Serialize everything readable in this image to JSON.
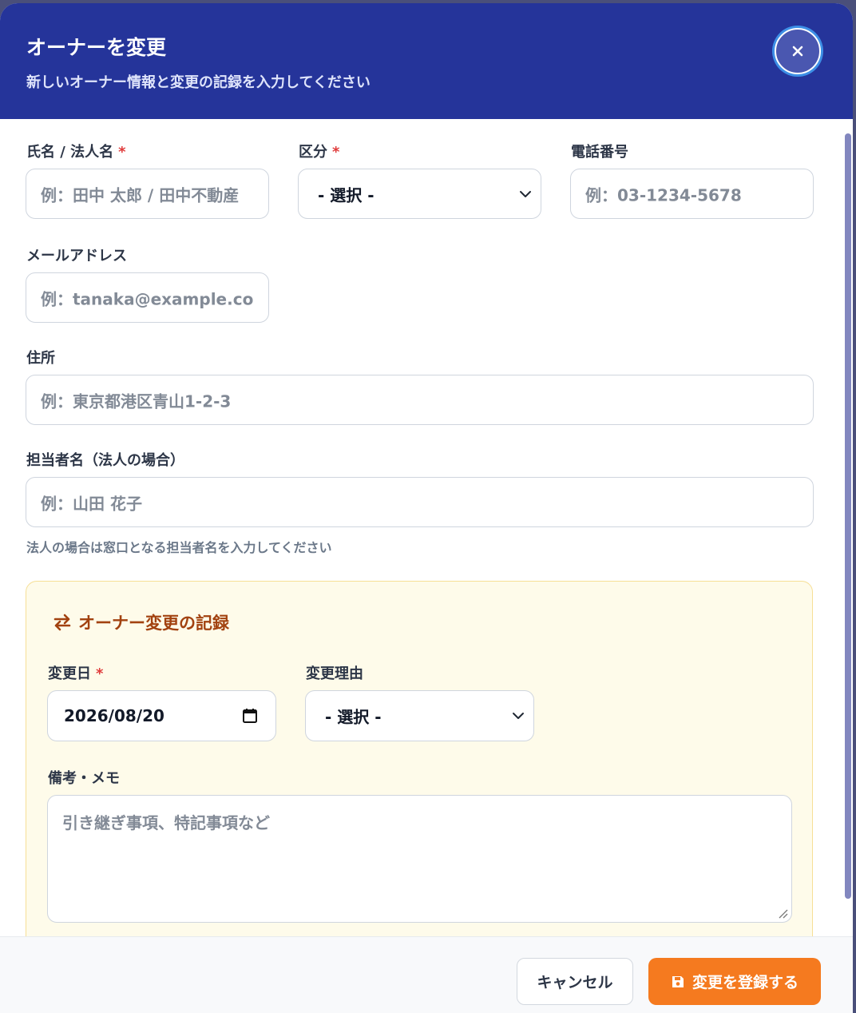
{
  "header": {
    "title": "オーナーを変更",
    "subtitle": "新しいオーナー情報と変更の記録を入力してください",
    "close_icon": "close-icon",
    "bg_color": "#25349a"
  },
  "form": {
    "name": {
      "label": "氏名 / 法人名",
      "required": "*",
      "placeholder": "例：田中 太郎 / 田中不動産"
    },
    "category": {
      "label": "区分",
      "required": "*",
      "value": "- 選択 -"
    },
    "phone": {
      "label": "電話番号",
      "placeholder": "例：03-1234-5678"
    },
    "email": {
      "label": "メールアドレス",
      "placeholder": "例：tanaka@example.co"
    },
    "address": {
      "label": "住所",
      "placeholder": "例：東京都港区青山1-2-3"
    },
    "contact": {
      "label": "担当者名（法人の場合）",
      "placeholder": "例：山田 花子",
      "hint": "法人の場合は窓口となる担当者名を入力してください"
    }
  },
  "record": {
    "title": "オーナー変更の記録",
    "icon": "swap-arrows-icon",
    "change_date": {
      "label": "変更日",
      "required": "*",
      "value": "2026/08/20",
      "icon": "calendar-icon"
    },
    "reason": {
      "label": "変更理由",
      "value": "- 選択 -"
    },
    "memo": {
      "label": "備考・メモ",
      "placeholder": "引き継ぎ事項、特記事項など"
    },
    "accent_color": "#a24210"
  },
  "footer": {
    "cancel_label": "キャンセル",
    "submit_label": "変更を登録する",
    "submit_icon": "save-icon",
    "submit_color": "#f57a1f"
  }
}
